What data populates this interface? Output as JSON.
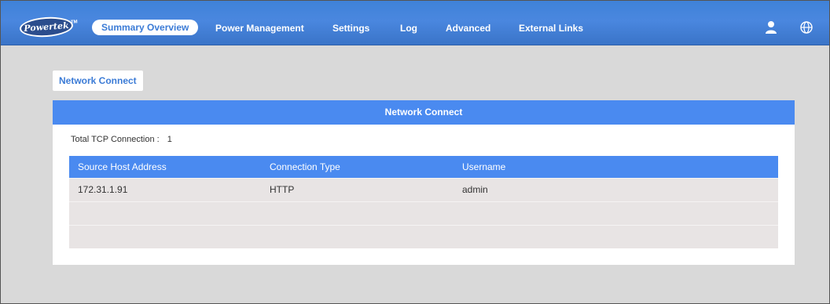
{
  "header": {
    "logo_text": "Powertek",
    "logo_tm": "TM",
    "nav": [
      {
        "label": "Summary Overview",
        "active": true
      },
      {
        "label": "Power Management",
        "active": false
      },
      {
        "label": "Settings",
        "active": false
      },
      {
        "label": "Log",
        "active": false
      },
      {
        "label": "Advanced",
        "active": false
      },
      {
        "label": "External Links",
        "active": false
      }
    ],
    "icons": [
      "user-icon",
      "globe-icon"
    ]
  },
  "tab": {
    "label": "Network Connect"
  },
  "panel": {
    "title": "Network Connect",
    "total_label": "Total TCP Connection :",
    "total_value": "1",
    "table": {
      "columns": [
        "Source Host Address",
        "Connection Type",
        "Username"
      ],
      "rows": [
        [
          "172.31.1.91",
          "HTTP",
          "admin"
        ],
        [
          "",
          "",
          ""
        ],
        [
          "",
          "",
          ""
        ]
      ]
    }
  },
  "colors": {
    "nav_bg": "#4a87df",
    "accent": "#4a8af0",
    "page_bg": "#d9d9d9",
    "row_bg": "#e8e4e4"
  }
}
